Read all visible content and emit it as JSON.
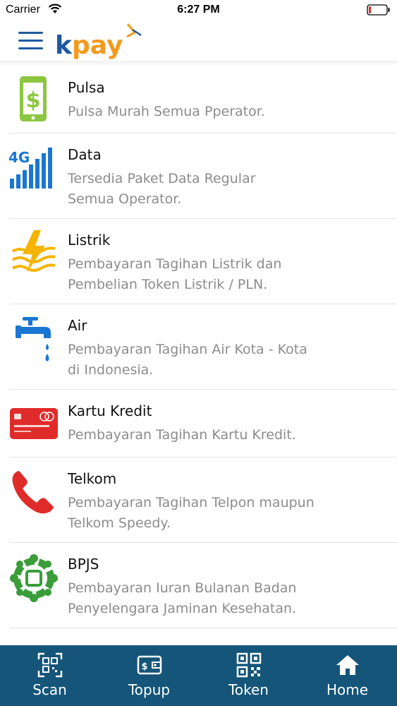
{
  "status_bar": {
    "carrier": "Carrier",
    "time": "6:27 PM"
  },
  "header": {
    "logo_text": "kpay"
  },
  "colors": {
    "brand_blue": "#1f5aa0",
    "brand_orange": "#f39a1e",
    "nav_bg": "#145579",
    "divider": "#e3e3e3",
    "desc_gray": "#8c8c8c"
  },
  "services": [
    {
      "title": "Pulsa",
      "description": "Pulsa Murah Semua Pperator.",
      "icon": "phone-dollar-icon"
    },
    {
      "title": "Data",
      "description": "Tersedia Paket Data Regular\nSemua Operator.",
      "icon": "signal-4g-icon"
    },
    {
      "title": "Listrik",
      "description": "Pembayaran Tagihan Listrik dan\nPembelian Token Listrik / PLN.",
      "icon": "lightning-icon"
    },
    {
      "title": "Air",
      "description": "Pembayaran Tagihan Air Kota - Kota\ndi Indonesia.",
      "icon": "water-tap-icon"
    },
    {
      "title": "Kartu Kredit",
      "description": "Pembayaran Tagihan Kartu Kredit.",
      "icon": "credit-card-icon"
    },
    {
      "title": "Telkom",
      "description": "Pembayaran Tagihan Telpon maupun\nTelkom Speedy.",
      "icon": "telephone-icon"
    },
    {
      "title": "BPJS",
      "description": "Pembayaran Iuran Bulanan Badan\nPenyelengara Jaminan Kesehatan.",
      "icon": "bpjs-icon"
    }
  ],
  "bottom_nav": [
    {
      "label": "Scan",
      "icon": "qr-scan-icon"
    },
    {
      "label": "Topup",
      "icon": "wallet-icon"
    },
    {
      "label": "Token",
      "icon": "qr-code-icon"
    },
    {
      "label": "Home",
      "icon": "home-icon"
    }
  ]
}
